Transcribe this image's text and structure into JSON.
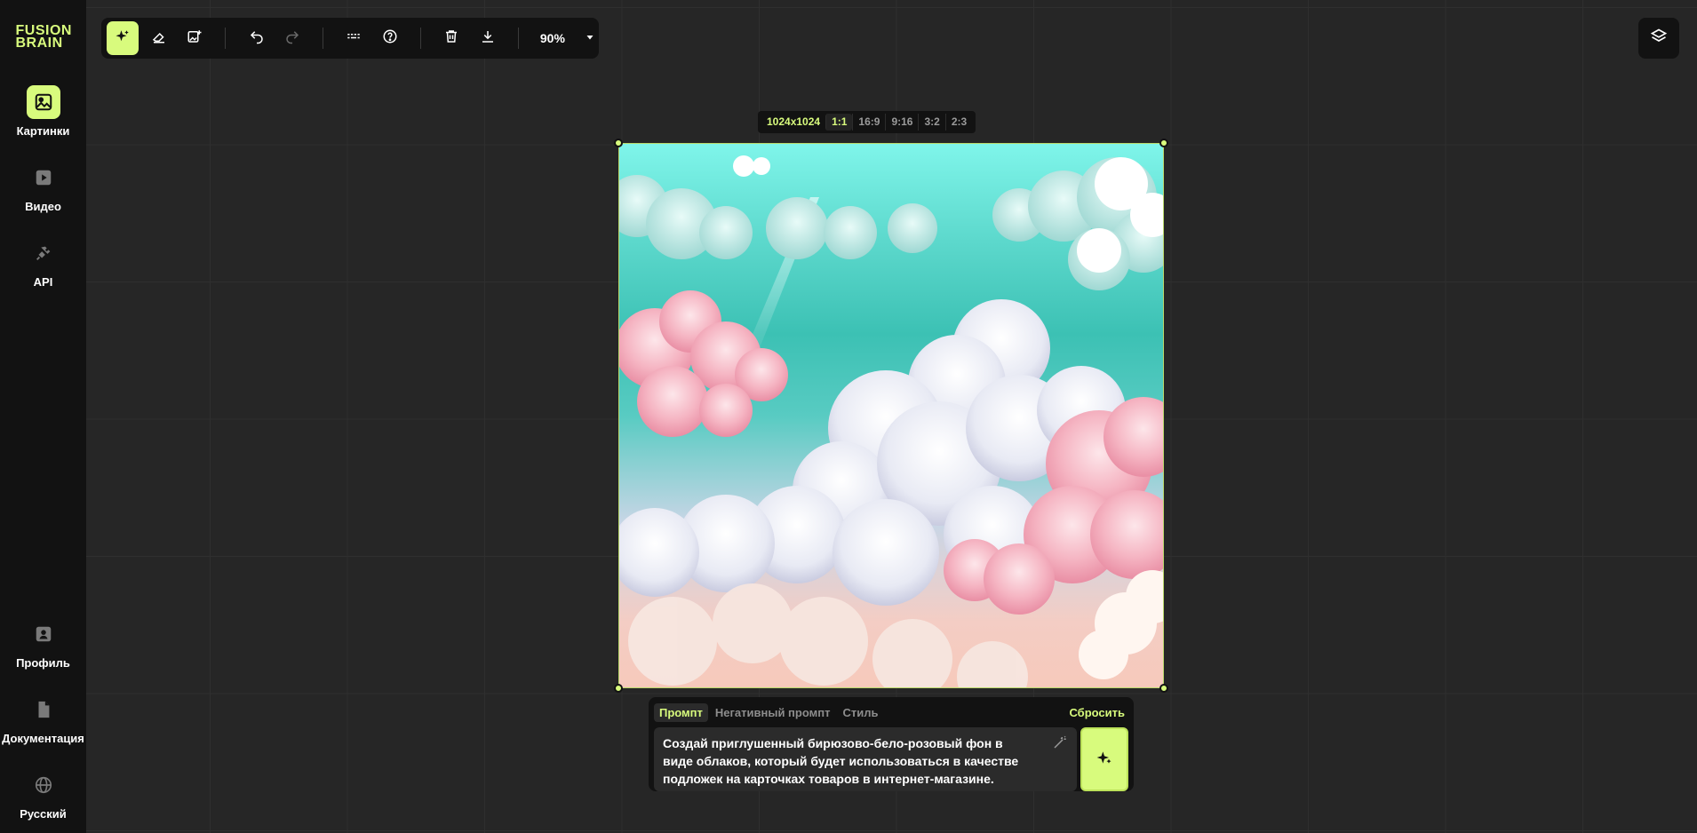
{
  "logo": {
    "line1": "FUSION",
    "line2": "BRAIN"
  },
  "sidebar": {
    "top_items": [
      {
        "label": "Картинки",
        "icon": "image-icon",
        "active": true
      },
      {
        "label": "Видео",
        "icon": "play-icon",
        "active": false
      },
      {
        "label": "API",
        "icon": "plug-icon",
        "active": false
      }
    ],
    "bottom_items": [
      {
        "label": "Профиль",
        "icon": "profile-icon"
      },
      {
        "label": "Документация",
        "icon": "document-icon"
      },
      {
        "label": "Русский",
        "icon": "globe-icon"
      }
    ]
  },
  "toolbar": {
    "zoom": "90%",
    "tools": [
      "generate-icon",
      "eraser-icon",
      "image-edit-icon",
      "undo-icon",
      "redo-icon",
      "shortcuts-icon",
      "help-icon",
      "trash-icon",
      "download-icon"
    ]
  },
  "aspect": {
    "resolution": "1024x1024",
    "options": [
      "1:1",
      "16:9",
      "9:16",
      "3:2",
      "2:3"
    ],
    "selected": "1:1"
  },
  "prompt": {
    "tabs": [
      "Промпт",
      "Негативный промпт",
      "Стиль"
    ],
    "active_tab": "Промпт",
    "reset_label": "Сбросить",
    "text": "Создай приглушенный бирюзово-бело-розовый фон в виде облаков, который будет использоваться в качестве подложек на карточках товаров в интернет-магазине."
  },
  "colors": {
    "accent": "#d8fb7d",
    "panel": "#121212",
    "canvas": "#262626"
  }
}
